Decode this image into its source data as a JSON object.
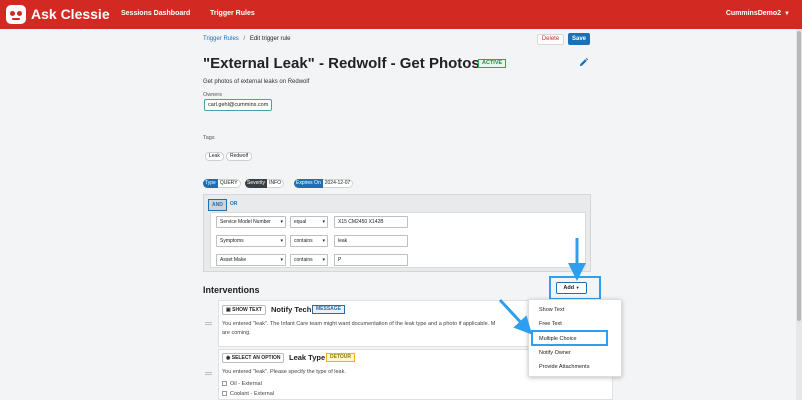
{
  "app": {
    "brand": "Ask Clessie",
    "account": "CumminsDemo2"
  },
  "nav": {
    "sessions": "Sessions Dashboard",
    "triggers": "Trigger Rules"
  },
  "breadcrumb": {
    "parent": "Trigger Rules",
    "sep": "/",
    "current": "Edit trigger rule"
  },
  "actions": {
    "delete": "Delete",
    "save": "Save"
  },
  "rule": {
    "title": "\"External Leak\" - Redwolf - Get Photos",
    "status": "ACTIVE",
    "description": "Get photos of external leaks on Redwolf",
    "owners_label": "Owners",
    "owner": "carl.gehl@cummins.com",
    "tags_label": "Tags",
    "tags": [
      "Leak",
      "Redwolf"
    ],
    "meta": [
      {
        "key": "Type",
        "value": "QUERY",
        "color": "#1f6fb2"
      },
      {
        "key": "Severity",
        "value": "INFO",
        "color": "#3a3f46"
      },
      {
        "key": "Expires On",
        "value": "2024-12-07",
        "color": "#1f6fb2"
      }
    ]
  },
  "conditions": {
    "and_label": "AND",
    "or_label": "OR",
    "rows": [
      {
        "field": "Service Model Number",
        "op": "equal",
        "value": "X15 CM2450 X142B"
      },
      {
        "field": "Symptoms",
        "op": "contains",
        "value": "leak"
      },
      {
        "field": "Asset Make",
        "op": "contains",
        "value": "P"
      }
    ]
  },
  "interventions": {
    "heading": "Interventions",
    "add_label": "Add",
    "cards": [
      {
        "type_badge": "SHOW TEXT",
        "title": "Notify Tech",
        "kind": "MESSAGE",
        "text": "You entered \"leak\". The Infant Care team might want documentation of the leak type and a photo if applicable. M",
        "text2": "are coming."
      },
      {
        "type_badge": "SELECT AN OPTION",
        "title": "Leak Type",
        "kind": "DETOUR",
        "text": "You entered \"leak\". Please specify the type of leak.",
        "options": [
          "Oil - External",
          "Coolant - External"
        ]
      }
    ],
    "menu": [
      "Show Text",
      "Free Text",
      "Multiple Choice",
      "Notify Owner",
      "Provide Attachments"
    ]
  },
  "colors": {
    "brand": "#d22a23",
    "primary": "#1f6fb2",
    "highlight": "#2e9ff0",
    "active": "#3ba34a",
    "detour": "#f3b21b"
  }
}
